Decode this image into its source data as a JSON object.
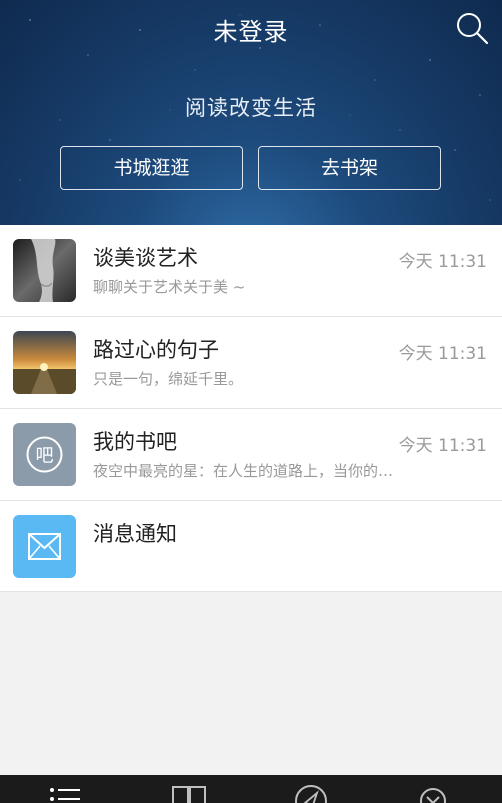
{
  "header": {
    "title": "未登录",
    "slogan": "阅读改变生活",
    "button_store": "书城逛逛",
    "button_shelf": "去书架"
  },
  "messages": [
    {
      "title": "谈美谈艺术",
      "subtitle": "聊聊关于艺术关于美 ~",
      "time": "今天 11:31",
      "avatar": "photo-figure"
    },
    {
      "title": "路过心的句子",
      "subtitle": "只是一句，绵延千里。",
      "time": "今天 11:31",
      "avatar": "photo-sunset-road"
    },
    {
      "title": "我的书吧",
      "subtitle": "夜空中最亮的星：在人生的道路上，当你的…",
      "time": "今天 11:31",
      "avatar": "bar-icon"
    },
    {
      "title": "消息通知",
      "subtitle": "",
      "time": "",
      "avatar": "envelope-icon"
    }
  ],
  "bar_icon_char": "吧",
  "colors": {
    "header_bg": "#163a66",
    "bar_icon_bg": "#8c9baa",
    "envelope_icon_bg": "#5ab9f3",
    "tabbar_bg": "#1b1b1b"
  },
  "tabbar": {
    "icons": [
      "list-icon",
      "book-icon",
      "compass-icon",
      "chevron-circle-icon"
    ]
  }
}
